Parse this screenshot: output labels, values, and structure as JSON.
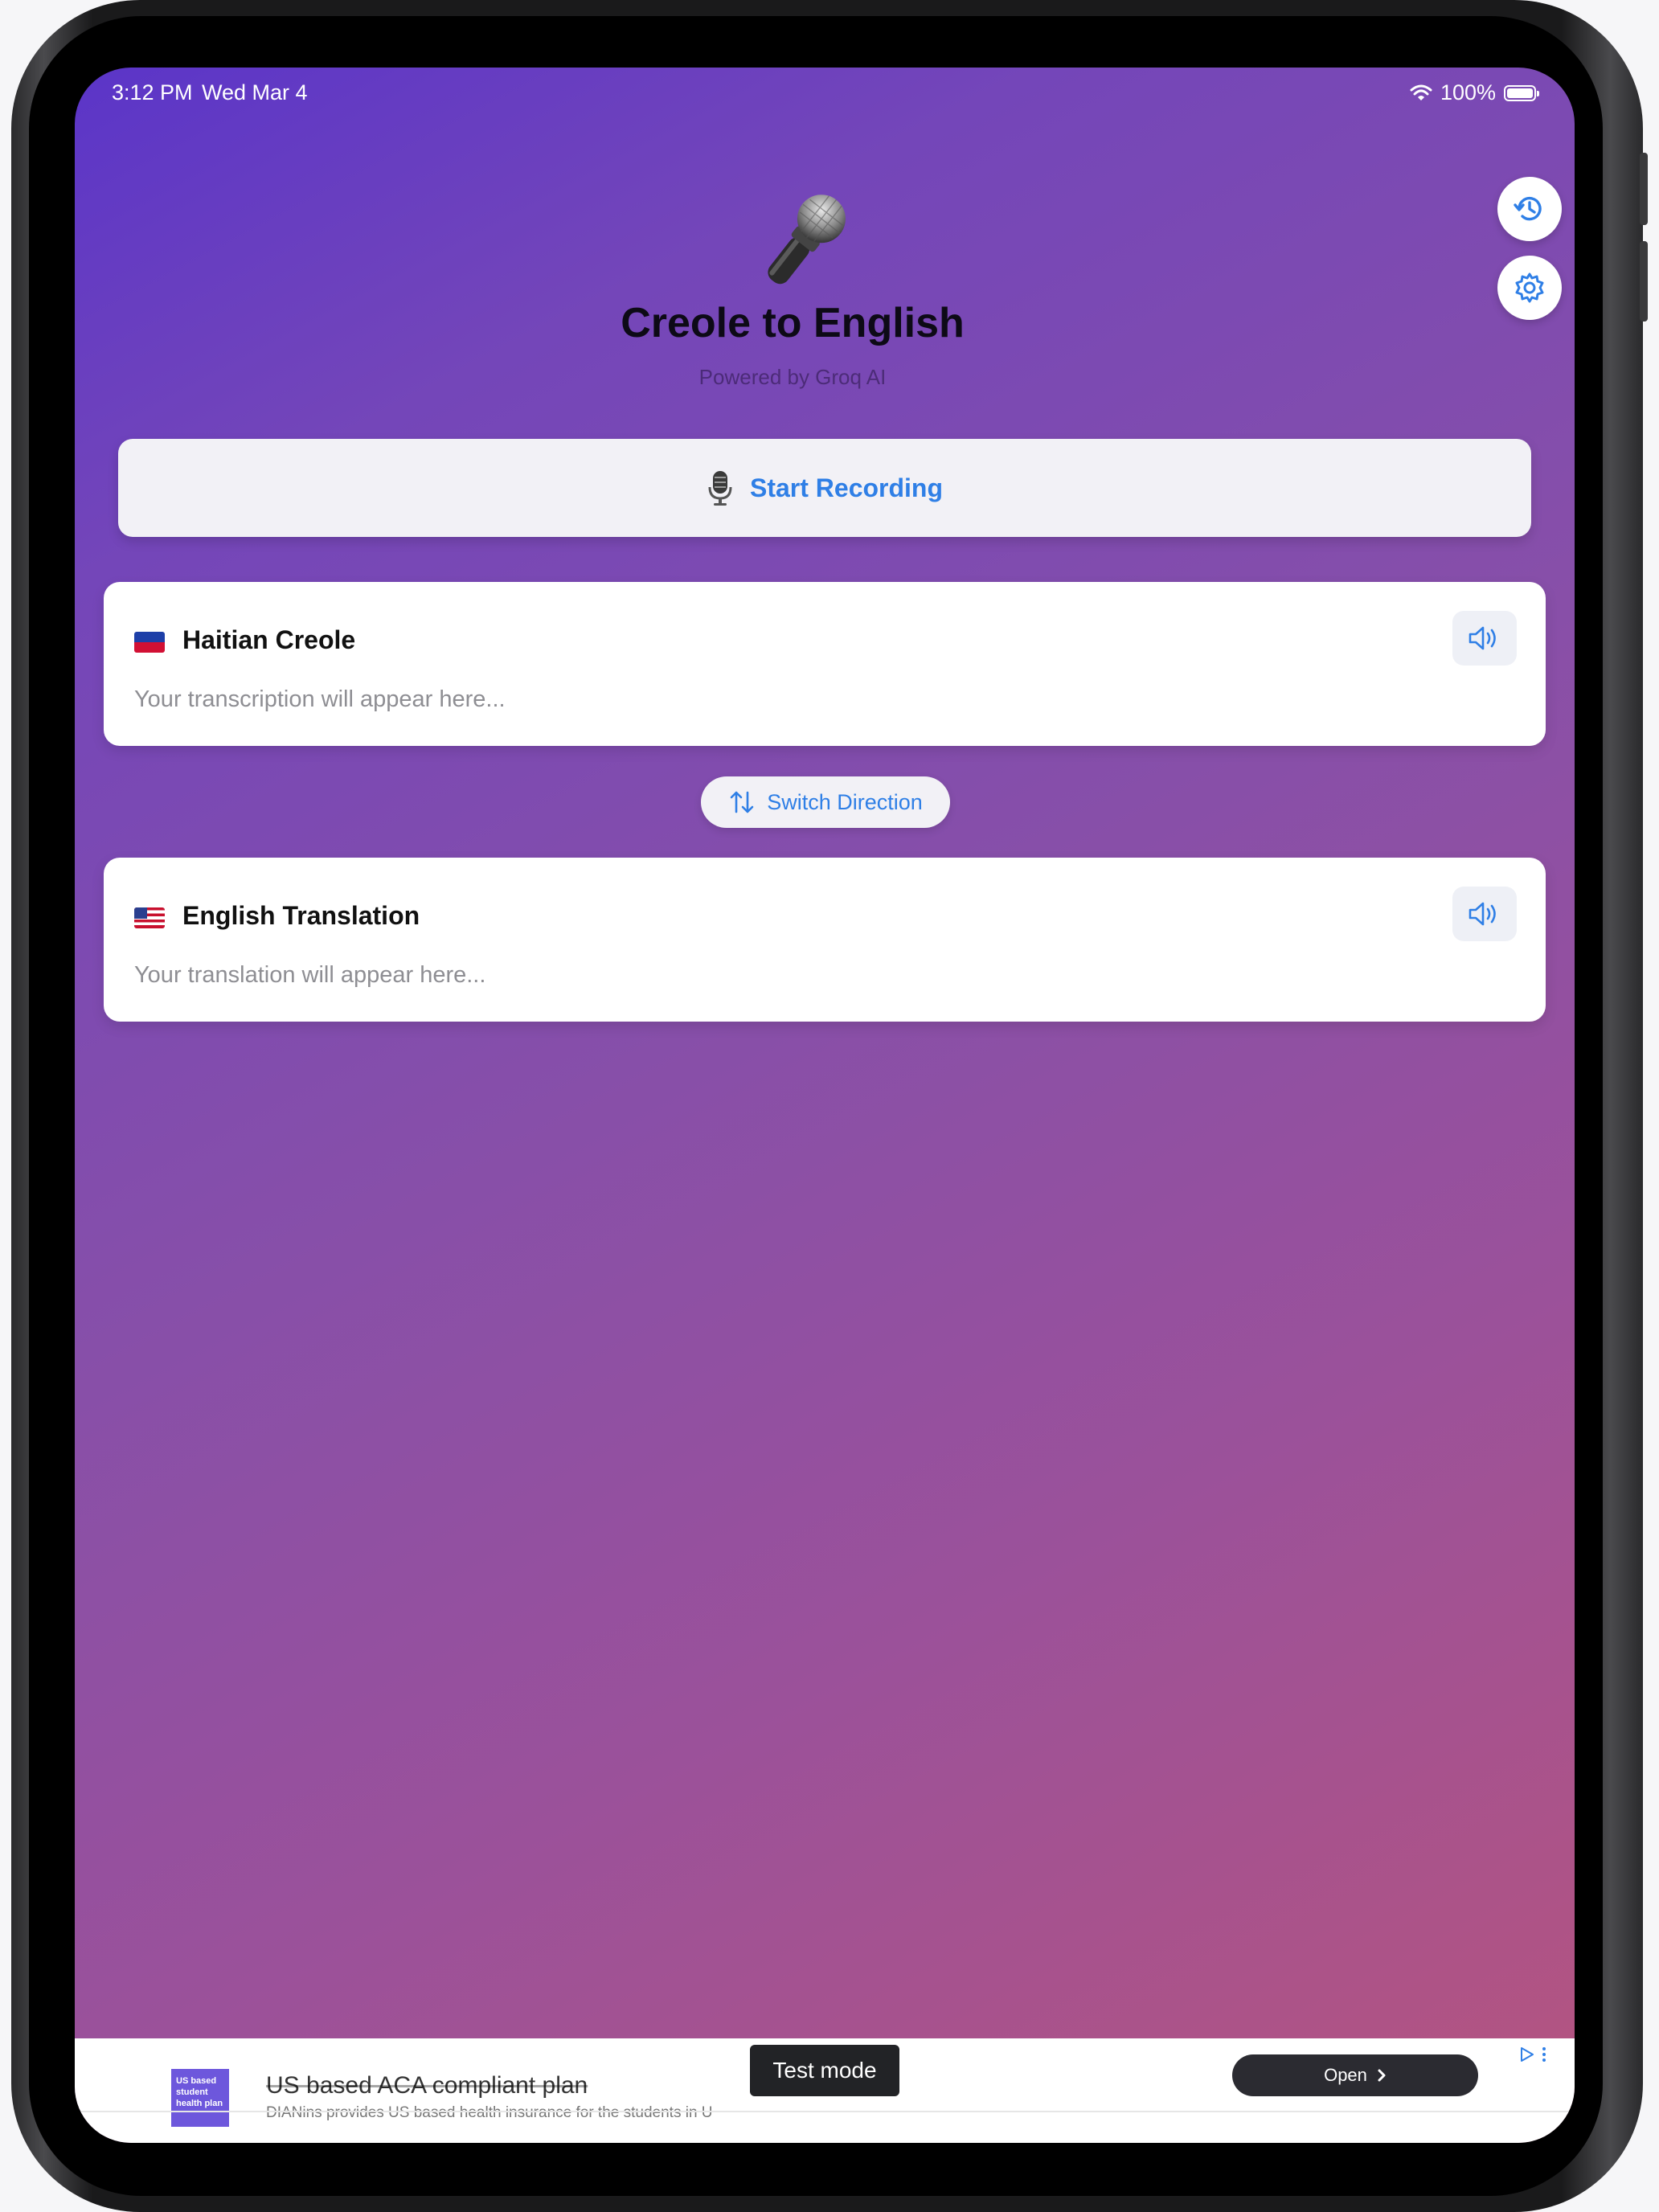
{
  "status_bar": {
    "time": "3:12 PM",
    "date": "Wed Mar 4",
    "battery": "100%"
  },
  "header": {
    "title": "Creole to English",
    "subtitle": "Powered by Groq AI"
  },
  "record_button": {
    "label": "Start Recording"
  },
  "source_card": {
    "title": "Haitian Creole",
    "placeholder": "Your transcription will appear here..."
  },
  "switch_button": {
    "label": "Switch Direction"
  },
  "target_card": {
    "title": "English Translation",
    "placeholder": "Your translation will appear here..."
  },
  "ad": {
    "thumb_text": "US based student health plan",
    "title": "US based ACA compliant plan",
    "description": "DIANins provides US based health insurance for the students in U",
    "test_mode": "Test mode",
    "open_label": "Open"
  },
  "colors": {
    "accent": "#2f7fe6",
    "gradient_start": "#5b35c8",
    "gradient_end": "#b5547f"
  },
  "icons": [
    "microphone-icon",
    "history-icon",
    "settings-icon",
    "studio-mic-icon",
    "speaker-icon",
    "swap-arrows-icon",
    "haiti-flag-icon",
    "us-flag-icon",
    "wifi-icon",
    "battery-icon",
    "chevron-right-icon",
    "ad-choices-icon"
  ]
}
